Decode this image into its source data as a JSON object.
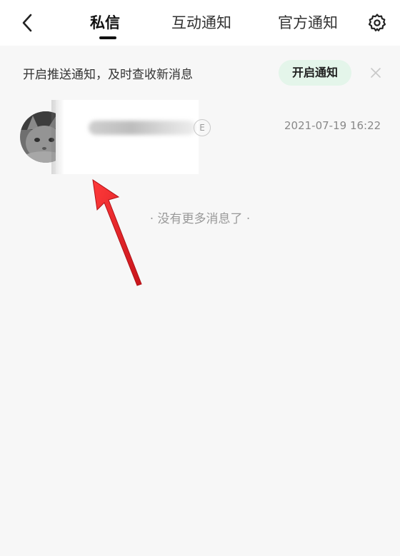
{
  "header": {
    "tabs": [
      {
        "label": "私信",
        "active": true
      },
      {
        "label": "互动通知",
        "active": false
      },
      {
        "label": "官方通知",
        "active": false
      }
    ]
  },
  "notice": {
    "text": "开启推送通知，及时查收新消息",
    "button_label": "开启通知"
  },
  "messages": [
    {
      "tag": "E",
      "time": "2021-07-19 16:22"
    }
  ],
  "end_hint": "· 没有更多消息了 ·",
  "colors": {
    "accent": "#e4f5ea",
    "annotation_arrow": "#e8202a"
  }
}
